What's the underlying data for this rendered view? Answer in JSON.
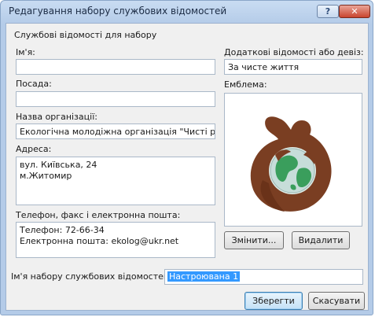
{
  "window": {
    "title": "Редагування набору службових відомостей"
  },
  "titlebar": {
    "help_label": "?",
    "close_label": "✕"
  },
  "group": {
    "label": "Службові відомості для набору"
  },
  "fields": {
    "name": {
      "label": "Ім'я:",
      "value": ""
    },
    "position": {
      "label": "Посада:",
      "value": ""
    },
    "organization": {
      "label": "Назва організації:",
      "value": "Екологічна молодіжна організація \"Чисті росі"
    },
    "address": {
      "label": "Адреса:",
      "value": "вул. Київська, 24\nм.Житомир"
    },
    "contacts": {
      "label": "Телефон, факс і електронна пошта:",
      "value": "Телефон: 72-66-34\nЕлектронна пошта: ekolog@ukr.net"
    },
    "motto": {
      "label": "Додаткові відомості або девіз:",
      "value": "За чисте життя"
    },
    "emblem": {
      "label": "Емблема:",
      "image_icon": "hands-holding-globe-icon"
    }
  },
  "buttons": {
    "change": "Змінити...",
    "delete": "Видалити",
    "save": "Зберегти",
    "cancel": "Скасувати"
  },
  "set_name": {
    "label": "Ім'я набору службових відомостей:",
    "value": "Настроювана 1"
  },
  "colors": {
    "title_bar": "#b4cbe8",
    "selection": "#3399ff",
    "emblem_brown": "#7a3e22",
    "globe_green": "#3a9e5c"
  }
}
